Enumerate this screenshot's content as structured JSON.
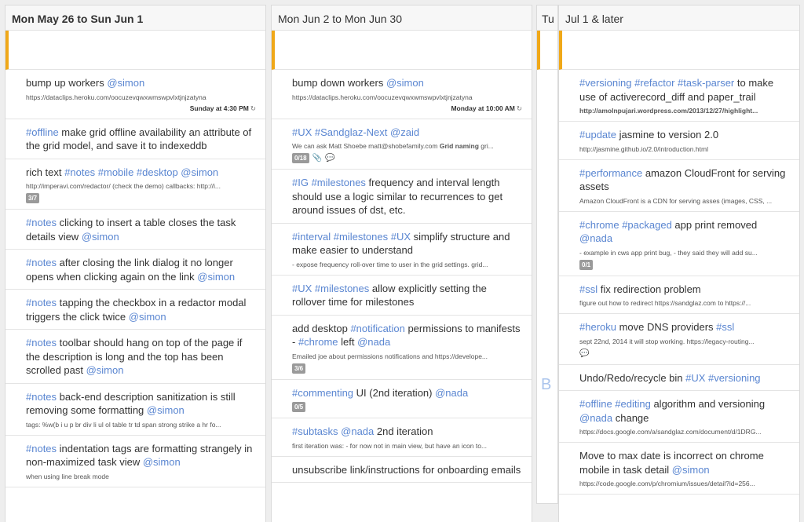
{
  "columns": [
    {
      "header": "Mon May 26 to Sun Jun 1",
      "tasks": [
        {
          "title": [
            [
              "bump up workers ",
              false
            ],
            [
              "@simon",
              true
            ]
          ],
          "note": "https://dataclips.heroku.com/oocuzevqwxwmswpvlxtjnjzatyna",
          "due": "Sunday at 4:30 PM",
          "repeat_icon": "↻"
        },
        {
          "title": [
            [
              "#offline",
              true
            ],
            [
              " make grid offline availability an attribute of the grid model, and save it to indexeddb",
              false
            ]
          ]
        },
        {
          "title": [
            [
              "rich text ",
              false
            ],
            [
              "#notes #mobile #desktop @simon",
              true
            ]
          ],
          "note": "http://imperavi.com/redactor/ (check the demo) callbacks: http://i...",
          "badge": "3/7"
        },
        {
          "title": [
            [
              "#notes",
              true
            ],
            [
              " clicking to insert a table closes the task details view ",
              false
            ],
            [
              "@simon",
              true
            ]
          ]
        },
        {
          "title": [
            [
              "#notes",
              true
            ],
            [
              " after closing the link dialog it no longer opens when clicking again on the link ",
              false
            ],
            [
              "@simon",
              true
            ]
          ]
        },
        {
          "title": [
            [
              "#notes",
              true
            ],
            [
              " tapping the checkbox in a redactor modal triggers the click twice ",
              false
            ],
            [
              "@simon",
              true
            ]
          ]
        },
        {
          "title": [
            [
              "#notes",
              true
            ],
            [
              " toolbar should hang on top of the page if the description is long and the top has been scrolled past ",
              false
            ],
            [
              "@simon",
              true
            ]
          ]
        },
        {
          "title": [
            [
              "#notes",
              true
            ],
            [
              " back-end description sanitization is still removing some formatting ",
              false
            ],
            [
              "@simon",
              true
            ]
          ],
          "note": "tags: %w(b i u p br div li ul ol table tr td span strong strike a hr fo..."
        },
        {
          "title": [
            [
              "#notes",
              true
            ],
            [
              " indentation tags are formatting strangely in non-maximized task view ",
              false
            ],
            [
              "@simon",
              true
            ]
          ],
          "note": "when using line break mode"
        }
      ]
    },
    {
      "header": "Mon Jun 2 to Mon Jun 30",
      "tasks": [
        {
          "title": [
            [
              "bump down workers ",
              false
            ],
            [
              "@simon",
              true
            ]
          ],
          "note": "https://dataclips.heroku.com/oocuzevqwxwmswpvlxtjnjzatyna",
          "due": "Monday at 10:00 AM",
          "repeat_icon": "↻"
        },
        {
          "title": [
            [
              "#UX #Sandglaz-Next @zaid",
              true
            ]
          ],
          "note_parts": [
            [
              "We can ask Matt Shoebe matt@shobefamily.com ",
              false
            ],
            [
              "Grid naming",
              true
            ],
            [
              " gri...",
              false
            ]
          ],
          "badge": "0/18",
          "icons": [
            "📎",
            "💬"
          ]
        },
        {
          "title": [
            [
              "#IG #milestones",
              true
            ],
            [
              " frequency and interval length should use a logic similar to recurrences to get around issues of dst, etc.",
              false
            ]
          ]
        },
        {
          "title": [
            [
              "#interval #milestones #UX",
              true
            ],
            [
              " simplify structure and make easier to understand",
              false
            ]
          ],
          "note": "- expose frequency roll-over time to user in the grid settings.  grid..."
        },
        {
          "title": [
            [
              "#UX #milestones",
              true
            ],
            [
              " allow explicitly setting the rollover time for milestones",
              false
            ]
          ]
        },
        {
          "title": [
            [
              "add desktop ",
              false
            ],
            [
              "#notification",
              true
            ],
            [
              " permissions to manifests - ",
              false
            ],
            [
              "#chrome",
              true
            ],
            [
              " left ",
              false
            ],
            [
              "@nada",
              true
            ]
          ],
          "note": "Emailed joe about permissions notifications and https://develope...",
          "badge": "3/6"
        },
        {
          "title": [
            [
              "#commenting",
              true
            ],
            [
              " UI (2nd iteration) ",
              false
            ],
            [
              "@nada",
              true
            ]
          ],
          "badge": "0/5"
        },
        {
          "title": [
            [
              "#subtasks @nada",
              true
            ],
            [
              " 2nd iteration",
              false
            ]
          ],
          "note": "first iteration was: - for now not in main view, but have an icon to..."
        },
        {
          "title": [
            [
              "unsubscribe link/instructions for onboarding emails",
              false
            ]
          ]
        }
      ]
    },
    {
      "header": "Tu",
      "peek_letter": "B"
    },
    {
      "header": "Jul 1 & later",
      "tasks": [
        {
          "title": [
            [
              "#versioning #refactor #task-parser",
              true
            ],
            [
              " to make use of activerecord_diff and paper_trail",
              false
            ]
          ],
          "note_bold": "http://amolnpujari.wordpress.com/2013/12/27/highlight..."
        },
        {
          "title": [
            [
              "#update",
              true
            ],
            [
              " jasmine to version 2.0",
              false
            ]
          ],
          "note": "http://jasmine.github.io/2.0/introduction.html"
        },
        {
          "title": [
            [
              "#performance",
              true
            ],
            [
              " amazon CloudFront for serving assets",
              false
            ]
          ],
          "note": "Amazon CloudFront is a CDN for serving asses (images, CSS, ..."
        },
        {
          "title": [
            [
              "#chrome #packaged",
              true
            ],
            [
              " app print removed ",
              false
            ],
            [
              "@nada",
              true
            ]
          ],
          "note": "- example in cws app print bug, - they said they will add su...",
          "badge": "0/1"
        },
        {
          "title": [
            [
              "#ssl",
              true
            ],
            [
              " fix redirection problem",
              false
            ]
          ],
          "note": "figure out how to redirect https://sandglaz.com to https://..."
        },
        {
          "title": [
            [
              "#heroku",
              true
            ],
            [
              " move DNS providers ",
              false
            ],
            [
              "#ssl",
              true
            ]
          ],
          "note": "sept 22nd, 2014 it will stop working. https://legacy-routing...",
          "icons": [
            "💬"
          ]
        },
        {
          "title": [
            [
              "Undo/Redo/recycle bin ",
              false
            ],
            [
              "#UX #versioning",
              true
            ]
          ]
        },
        {
          "title": [
            [
              "#offline #editing",
              true
            ],
            [
              " algorithm and versioning ",
              false
            ],
            [
              "@nada",
              true
            ],
            [
              " change",
              false
            ]
          ],
          "note": "https://docs.google.com/a/sandglaz.com/document/d/1DRG..."
        },
        {
          "title": [
            [
              "Move to max date is incorrect on chrome mobile in task detail ",
              false
            ],
            [
              "@simon",
              true
            ]
          ],
          "note": "https://code.google.com/p/chromium/issues/detail?id=256..."
        }
      ]
    }
  ]
}
